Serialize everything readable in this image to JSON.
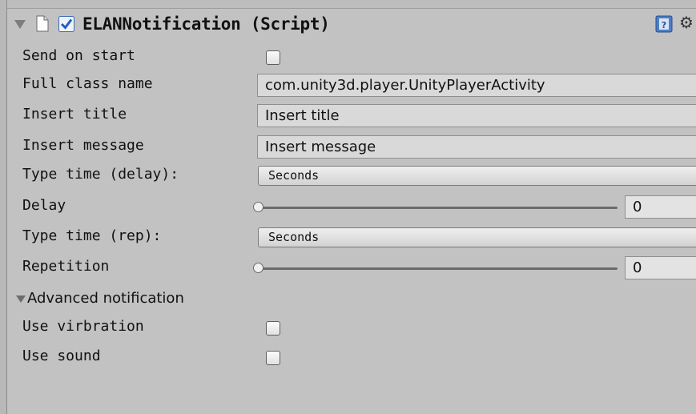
{
  "component": {
    "title": "ELANNotification (Script)",
    "enabled": true,
    "icons": {
      "fold": "triangle-down-icon",
      "script": "script-file-icon",
      "help": "help-book-icon",
      "settings": "gear-icon"
    }
  },
  "fields": {
    "send_on_start": {
      "label": "Send on start",
      "checked": false
    },
    "full_class_name": {
      "label": "Full class name",
      "value": "com.unity3d.player.UnityPlayerActivity"
    },
    "insert_title": {
      "label": "Insert title",
      "value": "Insert title"
    },
    "insert_message": {
      "label": "Insert message",
      "value": "Insert message"
    },
    "type_time_delay": {
      "label": "Type time (delay):",
      "value": "Seconds"
    },
    "delay": {
      "label": "Delay",
      "value": "0",
      "slider_fraction": 0
    },
    "type_time_rep": {
      "label": "Type time (rep):",
      "value": "Seconds"
    },
    "repetition": {
      "label": "Repetition",
      "value": "0",
      "slider_fraction": 0
    }
  },
  "advanced": {
    "label": "Advanced notification",
    "expanded": true,
    "use_vibration": {
      "label": "Use virbration",
      "checked": false
    },
    "use_sound": {
      "label": "Use sound",
      "checked": false
    }
  },
  "colors": {
    "panel": "#c2c2c2",
    "check_accent": "#3b78d8"
  }
}
